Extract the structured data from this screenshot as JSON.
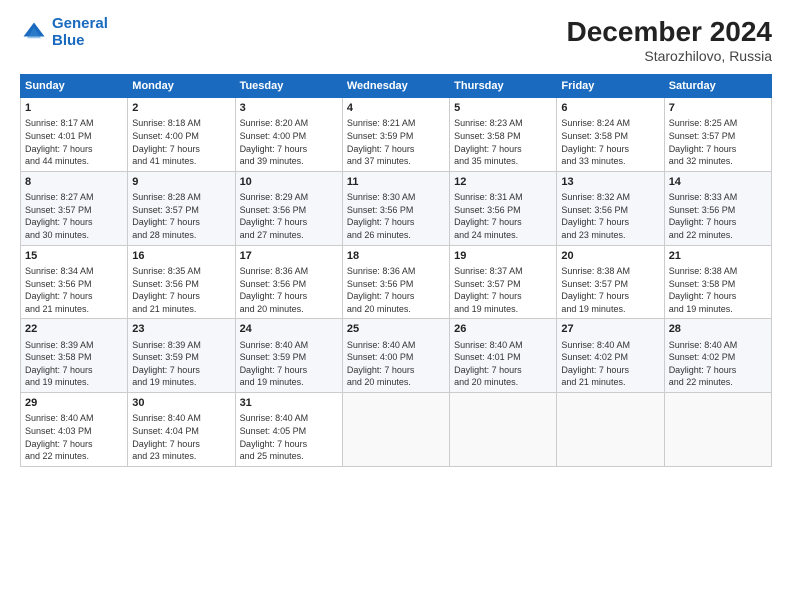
{
  "logo": {
    "line1": "General",
    "line2": "Blue"
  },
  "title": "December 2024",
  "subtitle": "Starozhilovo, Russia",
  "days_header": [
    "Sunday",
    "Monday",
    "Tuesday",
    "Wednesday",
    "Thursday",
    "Friday",
    "Saturday"
  ],
  "weeks": [
    [
      {
        "day": "1",
        "info": "Sunrise: 8:17 AM\nSunset: 4:01 PM\nDaylight: 7 hours\nand 44 minutes."
      },
      {
        "day": "2",
        "info": "Sunrise: 8:18 AM\nSunset: 4:00 PM\nDaylight: 7 hours\nand 41 minutes."
      },
      {
        "day": "3",
        "info": "Sunrise: 8:20 AM\nSunset: 4:00 PM\nDaylight: 7 hours\nand 39 minutes."
      },
      {
        "day": "4",
        "info": "Sunrise: 8:21 AM\nSunset: 3:59 PM\nDaylight: 7 hours\nand 37 minutes."
      },
      {
        "day": "5",
        "info": "Sunrise: 8:23 AM\nSunset: 3:58 PM\nDaylight: 7 hours\nand 35 minutes."
      },
      {
        "day": "6",
        "info": "Sunrise: 8:24 AM\nSunset: 3:58 PM\nDaylight: 7 hours\nand 33 minutes."
      },
      {
        "day": "7",
        "info": "Sunrise: 8:25 AM\nSunset: 3:57 PM\nDaylight: 7 hours\nand 32 minutes."
      }
    ],
    [
      {
        "day": "8",
        "info": "Sunrise: 8:27 AM\nSunset: 3:57 PM\nDaylight: 7 hours\nand 30 minutes."
      },
      {
        "day": "9",
        "info": "Sunrise: 8:28 AM\nSunset: 3:57 PM\nDaylight: 7 hours\nand 28 minutes."
      },
      {
        "day": "10",
        "info": "Sunrise: 8:29 AM\nSunset: 3:56 PM\nDaylight: 7 hours\nand 27 minutes."
      },
      {
        "day": "11",
        "info": "Sunrise: 8:30 AM\nSunset: 3:56 PM\nDaylight: 7 hours\nand 26 minutes."
      },
      {
        "day": "12",
        "info": "Sunrise: 8:31 AM\nSunset: 3:56 PM\nDaylight: 7 hours\nand 24 minutes."
      },
      {
        "day": "13",
        "info": "Sunrise: 8:32 AM\nSunset: 3:56 PM\nDaylight: 7 hours\nand 23 minutes."
      },
      {
        "day": "14",
        "info": "Sunrise: 8:33 AM\nSunset: 3:56 PM\nDaylight: 7 hours\nand 22 minutes."
      }
    ],
    [
      {
        "day": "15",
        "info": "Sunrise: 8:34 AM\nSunset: 3:56 PM\nDaylight: 7 hours\nand 21 minutes."
      },
      {
        "day": "16",
        "info": "Sunrise: 8:35 AM\nSunset: 3:56 PM\nDaylight: 7 hours\nand 21 minutes."
      },
      {
        "day": "17",
        "info": "Sunrise: 8:36 AM\nSunset: 3:56 PM\nDaylight: 7 hours\nand 20 minutes."
      },
      {
        "day": "18",
        "info": "Sunrise: 8:36 AM\nSunset: 3:56 PM\nDaylight: 7 hours\nand 20 minutes."
      },
      {
        "day": "19",
        "info": "Sunrise: 8:37 AM\nSunset: 3:57 PM\nDaylight: 7 hours\nand 19 minutes."
      },
      {
        "day": "20",
        "info": "Sunrise: 8:38 AM\nSunset: 3:57 PM\nDaylight: 7 hours\nand 19 minutes."
      },
      {
        "day": "21",
        "info": "Sunrise: 8:38 AM\nSunset: 3:58 PM\nDaylight: 7 hours\nand 19 minutes."
      }
    ],
    [
      {
        "day": "22",
        "info": "Sunrise: 8:39 AM\nSunset: 3:58 PM\nDaylight: 7 hours\nand 19 minutes."
      },
      {
        "day": "23",
        "info": "Sunrise: 8:39 AM\nSunset: 3:59 PM\nDaylight: 7 hours\nand 19 minutes."
      },
      {
        "day": "24",
        "info": "Sunrise: 8:40 AM\nSunset: 3:59 PM\nDaylight: 7 hours\nand 19 minutes."
      },
      {
        "day": "25",
        "info": "Sunrise: 8:40 AM\nSunset: 4:00 PM\nDaylight: 7 hours\nand 20 minutes."
      },
      {
        "day": "26",
        "info": "Sunrise: 8:40 AM\nSunset: 4:01 PM\nDaylight: 7 hours\nand 20 minutes."
      },
      {
        "day": "27",
        "info": "Sunrise: 8:40 AM\nSunset: 4:02 PM\nDaylight: 7 hours\nand 21 minutes."
      },
      {
        "day": "28",
        "info": "Sunrise: 8:40 AM\nSunset: 4:02 PM\nDaylight: 7 hours\nand 22 minutes."
      }
    ],
    [
      {
        "day": "29",
        "info": "Sunrise: 8:40 AM\nSunset: 4:03 PM\nDaylight: 7 hours\nand 22 minutes."
      },
      {
        "day": "30",
        "info": "Sunrise: 8:40 AM\nSunset: 4:04 PM\nDaylight: 7 hours\nand 23 minutes."
      },
      {
        "day": "31",
        "info": "Sunrise: 8:40 AM\nSunset: 4:05 PM\nDaylight: 7 hours\nand 25 minutes."
      },
      {
        "day": "",
        "info": ""
      },
      {
        "day": "",
        "info": ""
      },
      {
        "day": "",
        "info": ""
      },
      {
        "day": "",
        "info": ""
      }
    ]
  ]
}
